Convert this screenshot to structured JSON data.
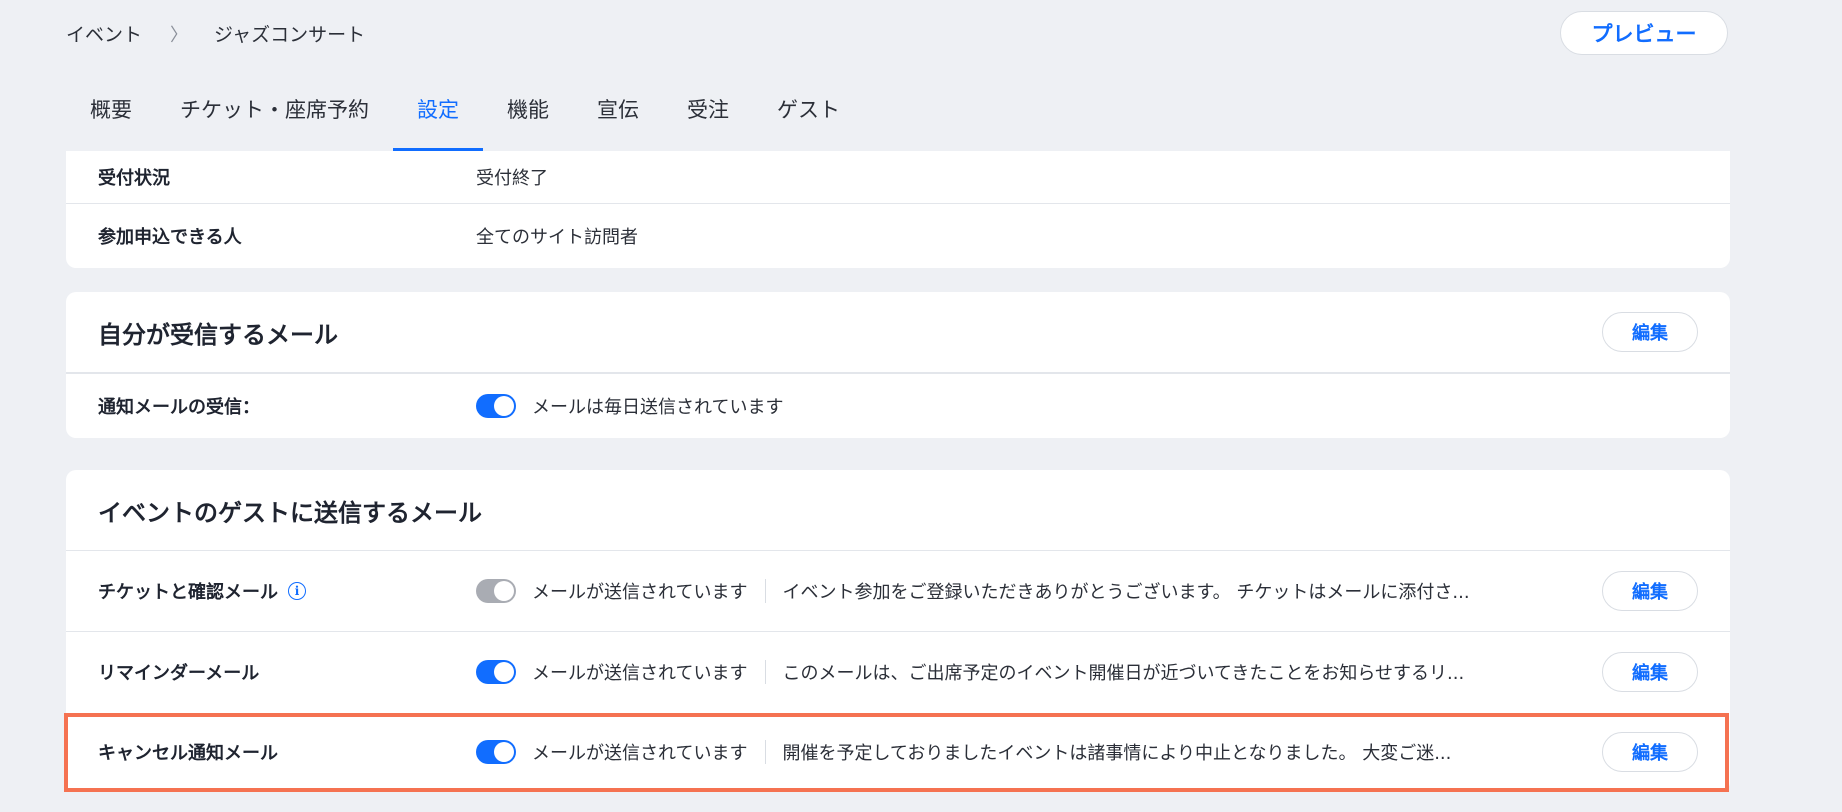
{
  "breadcrumb": {
    "parent": "イベント",
    "separator": "〉",
    "current": "ジャズコンサート"
  },
  "header": {
    "preview_label": "プレビュー"
  },
  "tabs": [
    {
      "label": "概要",
      "active": false
    },
    {
      "label": "チケット・座席予約",
      "active": false
    },
    {
      "label": "設定",
      "active": true
    },
    {
      "label": "機能",
      "active": false
    },
    {
      "label": "宣伝",
      "active": false
    },
    {
      "label": "受注",
      "active": false
    },
    {
      "label": "ゲスト",
      "active": false
    }
  ],
  "registration": {
    "status_label": "受付状況",
    "status_value": "受付終了",
    "who_label": "参加申込できる人",
    "who_value": "全てのサイト訪問者"
  },
  "my_emails": {
    "title": "自分が受信するメール",
    "edit_label": "編集",
    "notify_label": "通知メールの受信：",
    "notify_toggle_on": true,
    "notify_text": "メールは毎日送信されています"
  },
  "guest_emails": {
    "title": "イベントのゲストに送信するメール",
    "rows": [
      {
        "label": "チケットと確認メール",
        "has_info_icon": true,
        "toggle_on": false,
        "status": "メールが送信されています",
        "preview": "イベント参加をご登録いただきありがとうございます。 チケットはメールに添付さ...",
        "edit_label": "編集"
      },
      {
        "label": "リマインダーメール",
        "has_info_icon": false,
        "toggle_on": true,
        "status": "メールが送信されています",
        "preview": "このメールは、ご出席予定のイベント開催日が近づいてきたことをお知らせするリ...",
        "edit_label": "編集"
      },
      {
        "label": "キャンセル通知メール",
        "has_info_icon": false,
        "toggle_on": true,
        "status": "メールが送信されています",
        "preview": "開催を予定しておりましたイベントは諸事情により中止となりました。 大変ご迷...",
        "edit_label": "編集",
        "highlighted": true
      }
    ]
  },
  "colors": {
    "accent": "#116dff",
    "highlight": "#f57251",
    "toggle_off": "#a9acb3",
    "background": "#eef0f4"
  },
  "icons": {
    "info": "info-icon",
    "chevron": "chevron-right-icon"
  }
}
